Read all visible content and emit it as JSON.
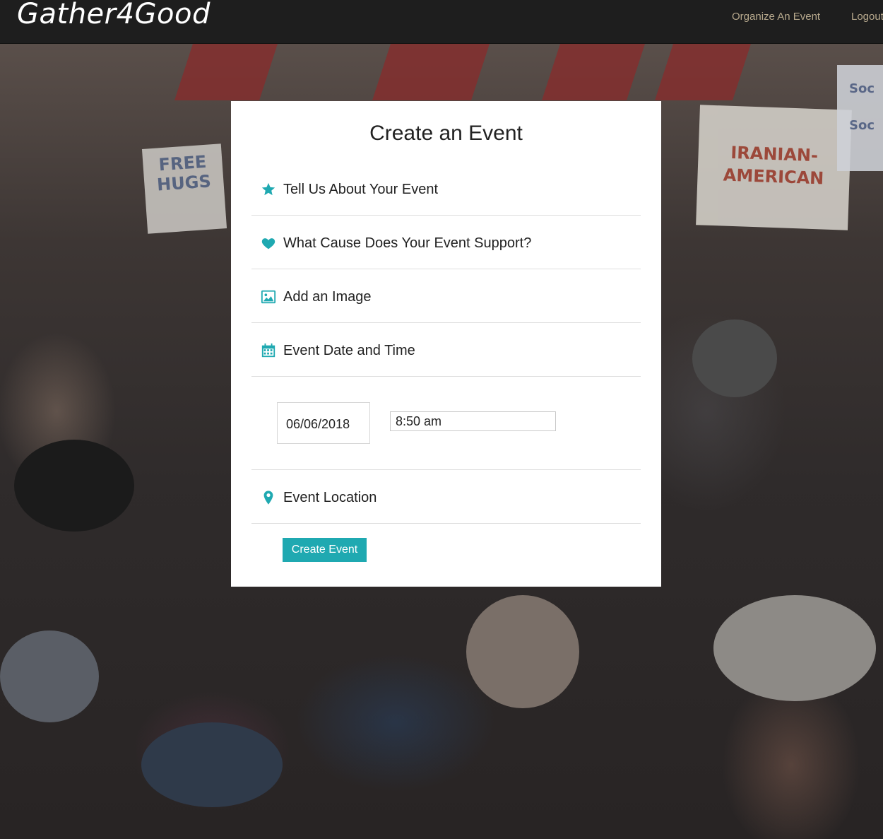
{
  "brand": "Gather4Good",
  "nav": {
    "organize": "Organize An Event",
    "logout": "Logout"
  },
  "background_signs": {
    "hugs": "FREE HUGS",
    "iranian": "IRANIAN-AMERICAN",
    "soc": "Soc Soc"
  },
  "form": {
    "title": "Create an Event",
    "sections": [
      {
        "label": "Tell Us About Your Event",
        "icon": "star-icon"
      },
      {
        "label": "What Cause Does Your Event Support?",
        "icon": "heart-icon"
      },
      {
        "label": "Add an Image",
        "icon": "image-icon"
      },
      {
        "label": "Event Date and Time",
        "icon": "calendar-icon"
      },
      {
        "label": "Event Location",
        "icon": "map-marker-icon"
      }
    ],
    "date_value": "06/06/2018",
    "time_value": "8:50 am",
    "submit_label": "Create Event"
  },
  "colors": {
    "accent": "#1fa9b1",
    "navbar": "#1e1e1e",
    "nav_link": "#b7a98d"
  }
}
